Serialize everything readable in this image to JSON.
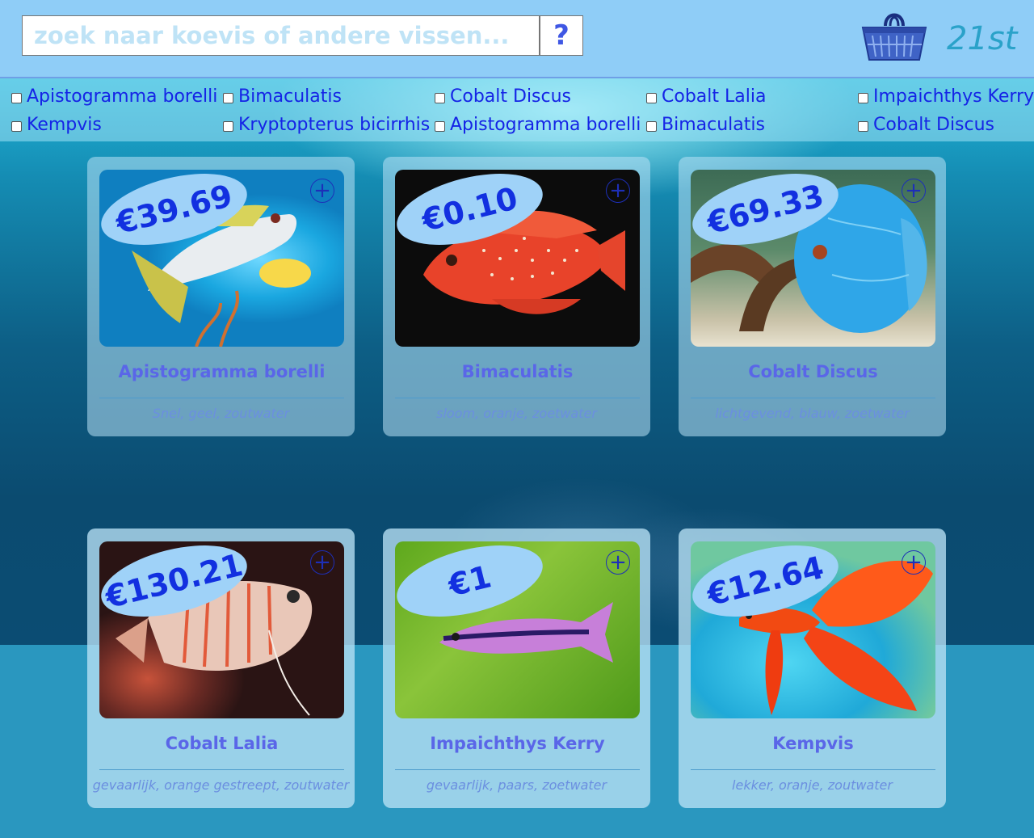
{
  "header": {
    "search_placeholder": "zoek naar koevis of andere vissen...",
    "search_button": "?",
    "basket_count": "21st"
  },
  "filters": [
    "Apistogramma borelli",
    "Bimaculatis",
    "Cobalt Discus",
    "Cobalt Lalia",
    "Impaichthys Kerry",
    "Kempvis",
    "Kryptopterus bicirrhis",
    "Apistogramma borelli",
    "Bimaculatis",
    "Cobalt Discus"
  ],
  "products": [
    {
      "price": "€39.69",
      "name": "Apistogramma borelli",
      "tags": "Snel, geel, zoutwater"
    },
    {
      "price": "€0.10",
      "name": "Bimaculatis",
      "tags": "sloom, oranje, zoetwater"
    },
    {
      "price": "€69.33",
      "name": "Cobalt Discus",
      "tags": "lichtgevend, blauw, zoetwater"
    },
    {
      "price": "€130.21",
      "name": "Cobalt Lalia",
      "tags": "gevaarlijk, orange gestreept, zoutwater"
    },
    {
      "price": "€1",
      "name": "Impaichthys Kerry",
      "tags": "gevaarlijk, paars, zoetwater"
    },
    {
      "price": "€12.64",
      "name": "Kempvis",
      "tags": "lekker, oranje, zoutwater"
    }
  ],
  "add_symbol": "+",
  "colors": {
    "header_bg": "#8fcdf7",
    "accent": "#1230e0",
    "name_color": "#5a66e8",
    "price_bubble": "#9fd2f8"
  }
}
